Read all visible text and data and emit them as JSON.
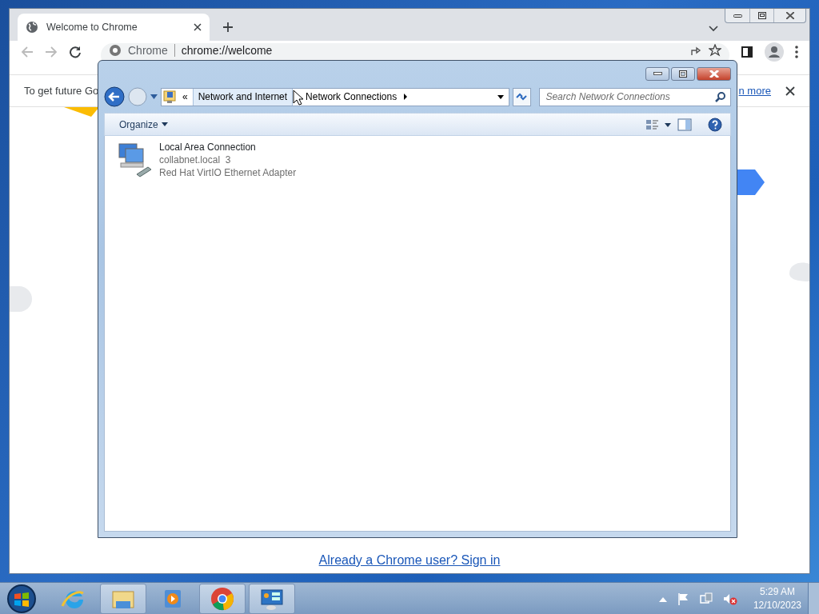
{
  "browser": {
    "tab": {
      "title": "Welcome to Chrome",
      "selected": true
    },
    "omnibox": {
      "chip": "Chrome",
      "url": "chrome://welcome"
    },
    "infobar": {
      "text": "To get future Go",
      "link": "n more"
    },
    "signin_link": "Already a Chrome user? Sign in"
  },
  "explorer": {
    "breadcrumbs": [
      {
        "label": "«",
        "kind": "overflow"
      },
      {
        "label": "Network and Internet",
        "kind": "crumb",
        "hovered": true
      },
      {
        "label": "Network Connections",
        "kind": "crumb",
        "hovered": false
      }
    ],
    "search": {
      "placeholder": "Search Network Connections"
    },
    "toolbar": {
      "organize": "Organize"
    },
    "items": [
      {
        "name": "Local Area Connection",
        "network": "collabnet.local  3",
        "device": "Red Hat VirtIO Ethernet Adapter"
      }
    ]
  },
  "taskbar": {
    "apps": [
      {
        "kind": "ie",
        "running": false
      },
      {
        "kind": "folder",
        "running": true
      },
      {
        "kind": "media",
        "running": false
      },
      {
        "kind": "chrome",
        "running": true
      },
      {
        "kind": "control",
        "running": true
      }
    ],
    "clock": {
      "time": "5:29 AM",
      "date": "12/10/2023"
    }
  }
}
